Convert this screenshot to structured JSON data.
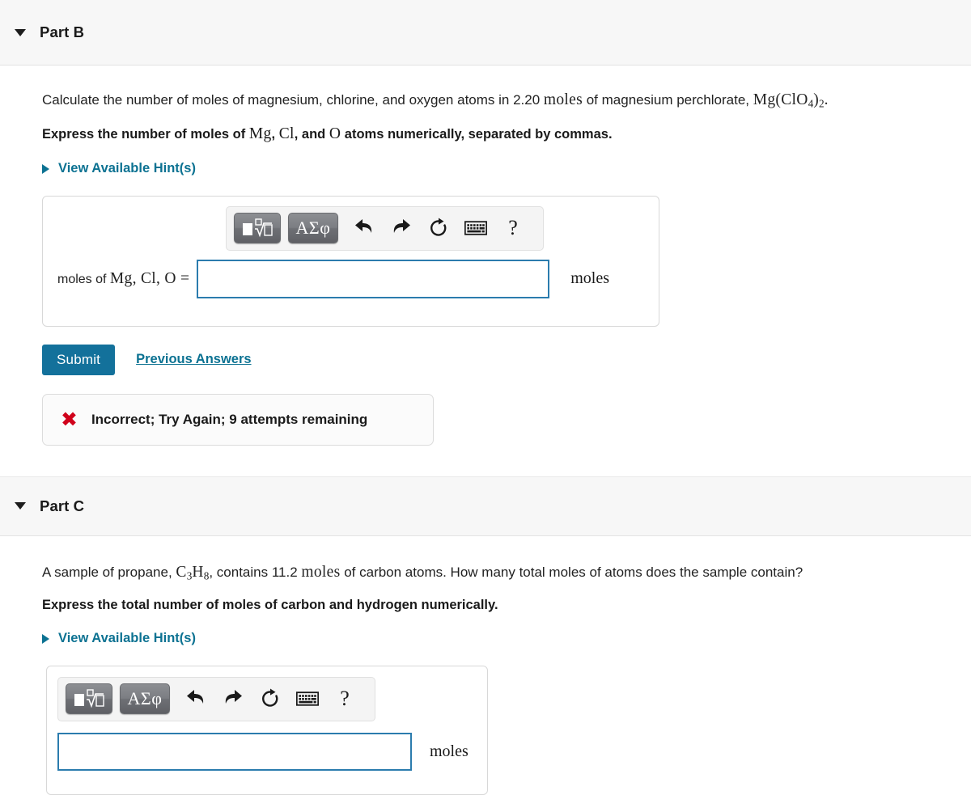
{
  "part_b": {
    "title": "Part B",
    "disclosure_icon": "chevron-down-icon",
    "question_pre": "Calculate the number of moles of magnesium, chlorine, and oxygen atoms in 2.20 ",
    "question_moles": "moles",
    "question_mid": " of magnesium perchlorate, ",
    "formula": "Mg(ClO4)2",
    "formula_parts": {
      "a": "Mg(ClO",
      "sub1": "4",
      "b": ")",
      "sub2": "2",
      "period": "."
    },
    "instruction_pre": "Express the number of moles of ",
    "instruction_mg": "Mg",
    "instruction_comma1": ", ",
    "instruction_cl": "Cl",
    "instruction_and": ", and ",
    "instruction_o": "O",
    "instruction_post": " atoms numerically, separated by commas.",
    "hint": {
      "label": "View Available Hint(s)",
      "icon": "triangle-right-icon"
    },
    "toolbar": {
      "template_button": "math-template-button",
      "greek_button": "ΑΣφ",
      "undo": "undo-arrow-icon",
      "redo": "redo-arrow-icon",
      "reset": "reset-circular-arrow-icon",
      "keyboard": "keyboard-icon",
      "help": "?"
    },
    "answer": {
      "label_pre": "moles of ",
      "label_mg": "Mg",
      "label_c1": ",  ",
      "label_cl": "Cl",
      "label_c2": ",  ",
      "label_o": "O",
      "label_eq": " =",
      "value": "",
      "placeholder": "",
      "unit": "moles"
    },
    "submit_label": "Submit",
    "previous_answers_label": "Previous Answers",
    "feedback": {
      "icon": "x-mark-icon",
      "symbol": "✖",
      "text": "Incorrect; Try Again; 9 attempts remaining",
      "color": "#d0021b"
    }
  },
  "part_c": {
    "title": "Part C",
    "disclosure_icon": "chevron-down-icon",
    "question_pre": "A sample of propane, ",
    "formula_parts": {
      "c": "C",
      "sub_c": "3",
      "h": "H",
      "sub_h": "8"
    },
    "question_mid": ", contains 11.2 ",
    "question_moles": "moles",
    "question_post": " of carbon atoms. How many total moles of atoms does the sample contain?",
    "instruction": "Express the total number of moles of carbon and hydrogen numerically.",
    "hint": {
      "label": "View Available Hint(s)",
      "icon": "triangle-right-icon"
    },
    "toolbar": {
      "template_button": "math-template-button",
      "greek_button": "ΑΣφ",
      "undo": "undo-arrow-icon",
      "redo": "redo-arrow-icon",
      "reset": "reset-circular-arrow-icon",
      "keyboard": "keyboard-icon",
      "help": "?"
    },
    "answer": {
      "value": "",
      "placeholder": "",
      "unit": "moles"
    }
  },
  "colors": {
    "accent_teal": "#0c7292",
    "submit_blue": "#13719b",
    "input_border": "#2b7cae",
    "error_red": "#d0021b",
    "header_band": "#f7f7f7"
  }
}
